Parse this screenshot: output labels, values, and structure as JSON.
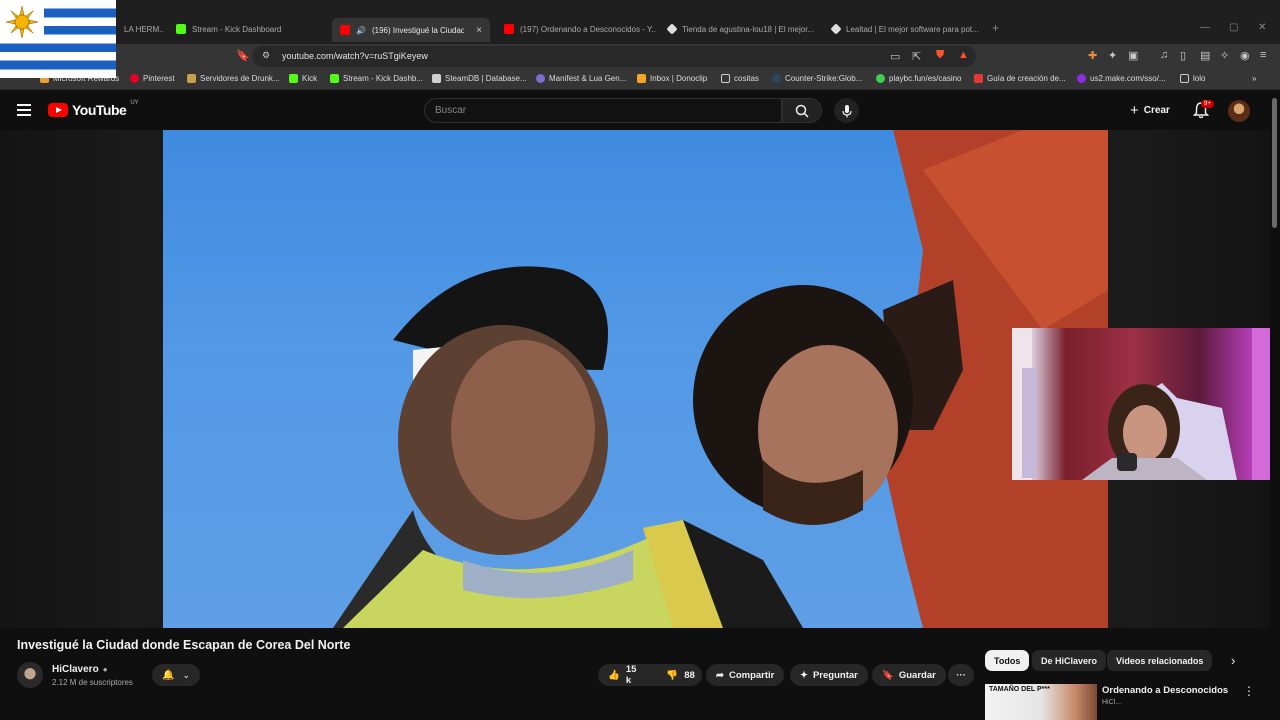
{
  "browser": {
    "tabs": [
      {
        "label": "LA HERM..."
      },
      {
        "label": "Stream - Kick Dashboard"
      },
      {
        "label": "(196) Investigué la Ciudad d..."
      },
      {
        "label": "(197) Ordenando a Desconocidos - Y..."
      },
      {
        "label": "Tienda de agustina-lou18 | El mejor..."
      },
      {
        "label": "Lealtad | El mejor software para pot..."
      }
    ],
    "new_tab": "+",
    "close_tab": "×",
    "url": "youtube.com/watch?v=ruSTgiKeyew",
    "bookmarks": [
      {
        "label": "Microsoft Rewards"
      },
      {
        "label": "Pinterest"
      },
      {
        "label": "Servidores de Drunk..."
      },
      {
        "label": "Kick"
      },
      {
        "label": "Stream - Kick Dashb..."
      },
      {
        "label": "SteamDB | Database..."
      },
      {
        "label": "Manifest & Lua Gen..."
      },
      {
        "label": "Inbox | Donoclip"
      },
      {
        "label": "cositas"
      },
      {
        "label": "Counter-Strike:Glob..."
      },
      {
        "label": "playbc.fun/es/casino"
      },
      {
        "label": "Guía de creación de..."
      },
      {
        "label": "us2.make.com/sso/..."
      },
      {
        "label": "lolo"
      }
    ],
    "more_bookmarks": "»"
  },
  "youtube": {
    "logo_text": "YouTube",
    "country_code": "UY",
    "search_placeholder": "Buscar",
    "create_label": "Crear",
    "notification_badge": "9+",
    "video": {
      "title": "Investigué la Ciudad donde Escapan de Corea Del Norte",
      "channel": "HiClavero",
      "subscribers": "2.12 M de suscriptores",
      "likes": "15 k",
      "dislikes": "88",
      "share_label": "Compartir",
      "ask_label": "Preguntar",
      "save_label": "Guardar",
      "more_label": "···"
    },
    "chips": [
      {
        "label": "Todos"
      },
      {
        "label": "De HiClavero"
      },
      {
        "label": "Videos relacionados"
      }
    ],
    "related": {
      "thumb_text": "TAMAÑO DEL P***",
      "title": "Ordenando a Desconocidos",
      "subtitle": "HiCl..."
    }
  },
  "colors": {
    "brand_red": "#ff0000",
    "background": "#0f0f0f",
    "chip": "#272727"
  }
}
